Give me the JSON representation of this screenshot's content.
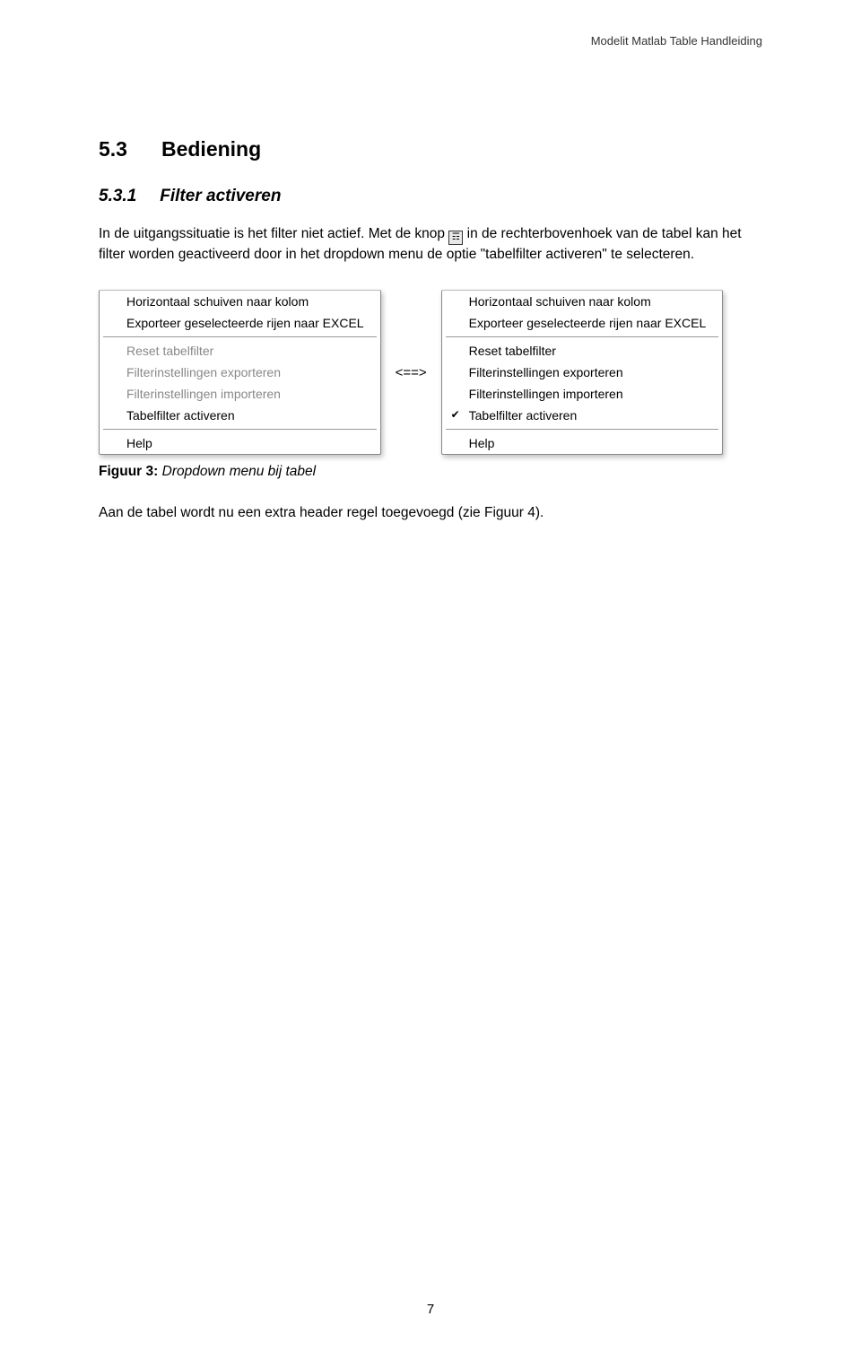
{
  "header": {
    "doc_title": "Modelit Matlab Table Handleiding"
  },
  "section": {
    "num": "5.3",
    "title": "Bediening"
  },
  "subsection": {
    "num": "5.3.1",
    "title": "Filter activeren"
  },
  "para1": {
    "line1": "In de uitgangssituatie is het filter niet actief. Met de knop ",
    "line2": " in de rechterbovenhoek van de tabel kan het filter worden geactiveerd door in het dropdown menu de optie \"tabelfilter activeren\" te selecteren."
  },
  "icon_button": {
    "glyph": "☶"
  },
  "menu_left": {
    "items": {
      "0": {
        "label": "Horizontaal schuiven naar kolom",
        "disabled": false,
        "checked": false
      },
      "1": {
        "label": "Exporteer geselecteerde rijen naar EXCEL",
        "disabled": false,
        "checked": false
      },
      "2": {
        "label": "Reset tabelfilter",
        "disabled": true,
        "checked": false
      },
      "3": {
        "label": "Filterinstellingen exporteren",
        "disabled": true,
        "checked": false
      },
      "4": {
        "label": "Filterinstellingen importeren",
        "disabled": true,
        "checked": false
      },
      "5": {
        "label": "Tabelfilter activeren",
        "disabled": false,
        "checked": false
      },
      "6": {
        "label": "Help",
        "disabled": false,
        "checked": false
      }
    }
  },
  "arrow": "<==>",
  "menu_right": {
    "items": {
      "0": {
        "label": "Horizontaal schuiven naar kolom",
        "disabled": false,
        "checked": false
      },
      "1": {
        "label": "Exporteer geselecteerde rijen naar EXCEL",
        "disabled": false,
        "checked": false
      },
      "2": {
        "label": "Reset tabelfilter",
        "disabled": false,
        "checked": false
      },
      "3": {
        "label": "Filterinstellingen exporteren",
        "disabled": false,
        "checked": false
      },
      "4": {
        "label": "Filterinstellingen importeren",
        "disabled": false,
        "checked": false
      },
      "5": {
        "label": "Tabelfilter activeren",
        "disabled": false,
        "checked": true
      },
      "6": {
        "label": "Help",
        "disabled": false,
        "checked": false
      }
    }
  },
  "caption": {
    "bold": "Figuur 3:",
    "rest": " Dropdown menu bij tabel"
  },
  "para2": "Aan de tabel wordt nu een extra header regel toegevoegd (zie Figuur 4).",
  "page_number": "7"
}
